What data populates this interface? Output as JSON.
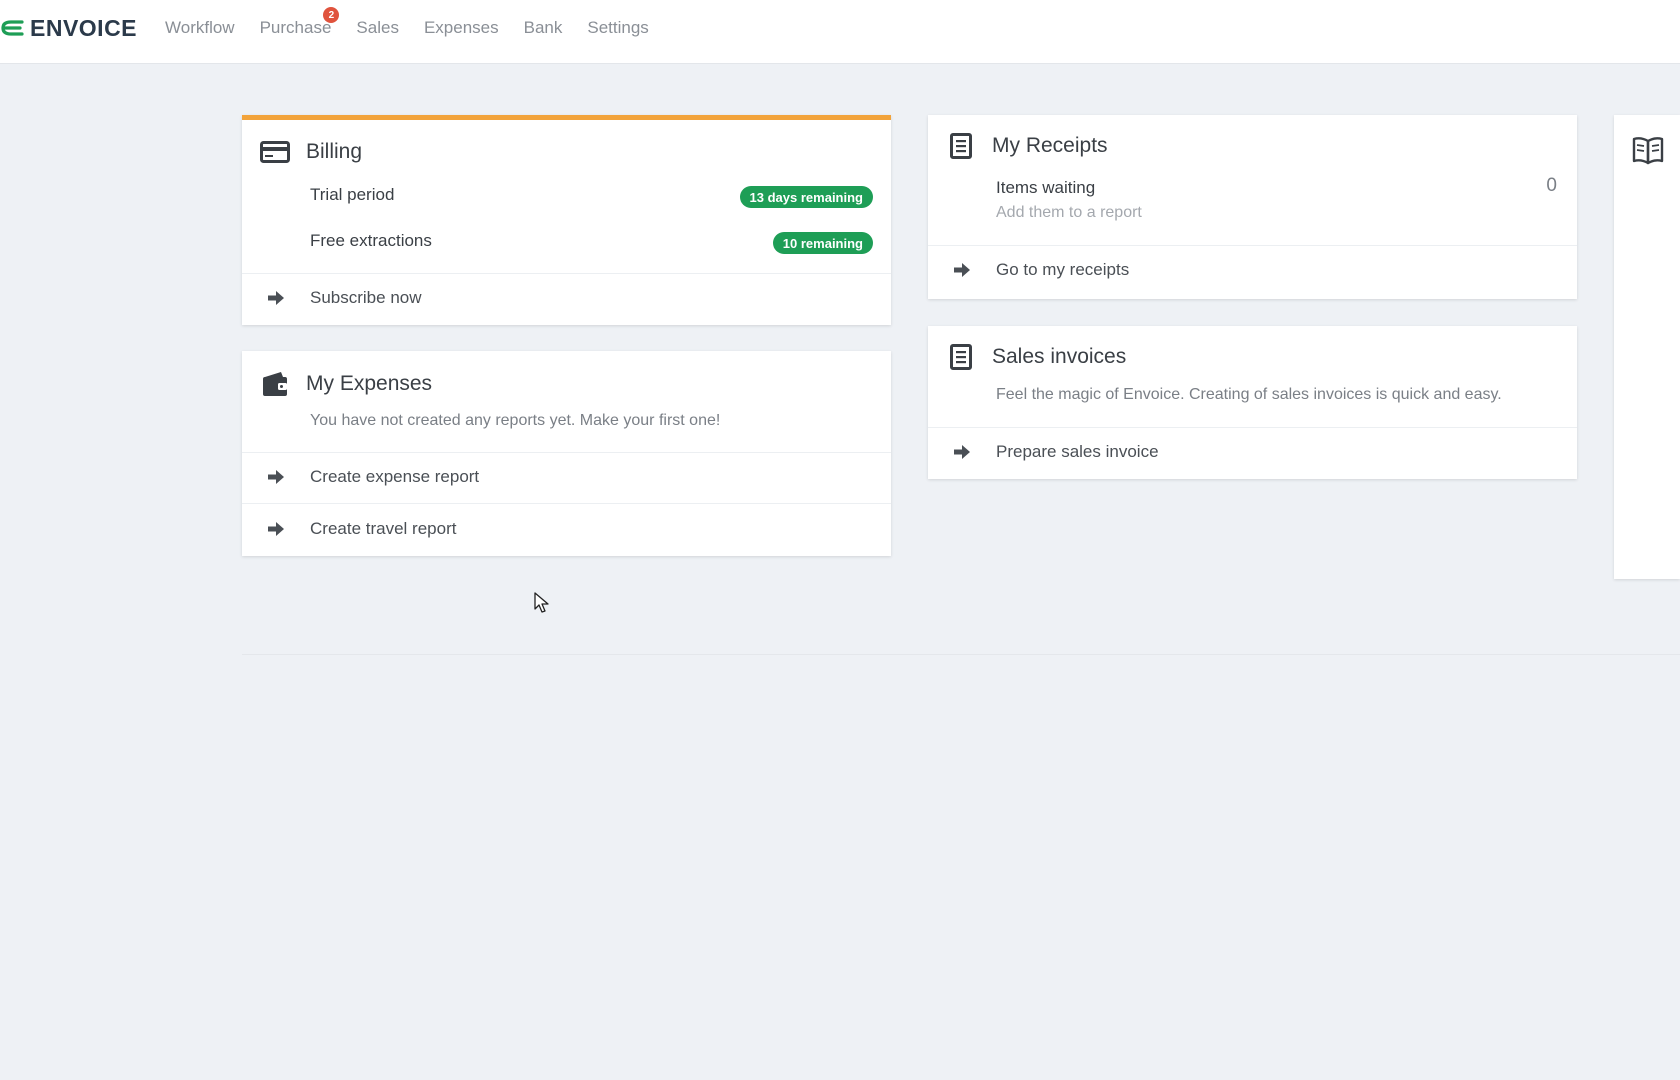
{
  "brand": {
    "name": "ENVOICE",
    "accent": "#1e9e56"
  },
  "nav": {
    "items": [
      {
        "label": "Workflow"
      },
      {
        "label": "Purchase",
        "badge": "2"
      },
      {
        "label": "Sales"
      },
      {
        "label": "Expenses"
      },
      {
        "label": "Bank"
      },
      {
        "label": "Settings"
      }
    ]
  },
  "billing": {
    "title": "Billing",
    "icon": "credit-card-icon",
    "rows": [
      {
        "label": "Trial period",
        "badge": "13 days remaining"
      },
      {
        "label": "Free extractions",
        "badge": "10 remaining"
      }
    ],
    "link": "Subscribe now"
  },
  "expenses": {
    "title": "My Expenses",
    "icon": "wallet-icon",
    "message": "You have not created any reports yet. Make your first one!",
    "links": [
      "Create expense report",
      "Create travel report"
    ]
  },
  "receipts": {
    "title": "My Receipts",
    "icon": "document-icon",
    "items_label": "Items waiting",
    "items_count": "0",
    "items_hint": "Add them to a report",
    "link": "Go to my receipts"
  },
  "sales_invoices": {
    "title": "Sales invoices",
    "icon": "document-icon",
    "message": "Feel the magic of Envoice. Creating of sales invoices is quick and easy.",
    "link": "Prepare sales invoice"
  },
  "side_panel": {
    "icon": "book-icon"
  }
}
